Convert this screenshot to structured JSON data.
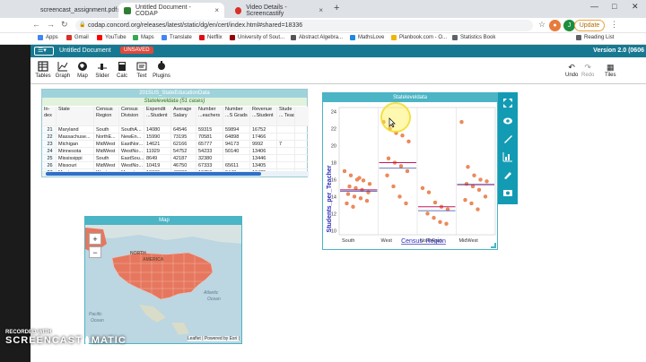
{
  "browser": {
    "tabs": [
      {
        "title": "screencast_assignment.pdf",
        "color": "#e94235"
      },
      {
        "title": "Untitled Document - CODAP",
        "color": "#2e7d32"
      },
      {
        "title": "Video Details - Screencastify",
        "color": "#d93025"
      }
    ],
    "url": "codap.concord.org/releases/latest/static/dg/en/cert/index.html#shared=18336",
    "update_label": "Update",
    "bookmarks": [
      {
        "label": "Apps",
        "color": "#4285f4"
      },
      {
        "label": "Gmail",
        "color": "#d93025"
      },
      {
        "label": "YouTube",
        "color": "#ff0000"
      },
      {
        "label": "Maps",
        "color": "#34a853"
      },
      {
        "label": "Translate",
        "color": "#4285f4"
      },
      {
        "label": "Netflix",
        "color": "#e50914"
      },
      {
        "label": "University of Sout...",
        "color": "#990000"
      },
      {
        "label": "Abstract Algebra...",
        "color": "#555555"
      },
      {
        "label": "MathsLove",
        "color": "#1e88e5"
      },
      {
        "label": "Planbook.com - O...",
        "color": "#f4b400"
      },
      {
        "label": "Statistics Book",
        "color": "#5f6368"
      }
    ],
    "reading_list": "Reading List"
  },
  "codap": {
    "doc_title": "Untitled Document",
    "unsaved": "UNSAVED",
    "version": "Version 2.0 (0606",
    "tools": [
      "Tables",
      "Graph",
      "Map",
      "Slider",
      "Calc",
      "Text",
      "Plugins"
    ],
    "right_tools": [
      "Undo",
      "Redo",
      "Tiles"
    ]
  },
  "table": {
    "title": "2015US_StateEducationData",
    "case_header": "Stateleveldata (51 cases)",
    "columns": [
      "In-\ndex",
      "State",
      "Census\nRegion",
      "Census\nDivision",
      "Expendit\n...Student",
      "Average\nSalary",
      "Number\n...eachers",
      "Number\n...S Grads",
      "Revenue\n...Student",
      "Stude\n... Teac"
    ],
    "rows": [
      [
        "21",
        "Maryland",
        "South",
        "SouthA...",
        "14080",
        "64546",
        "59315",
        "59894",
        "16752",
        ""
      ],
      [
        "22",
        "Massachuse...",
        "NorthE...",
        "NewEn...",
        "15990",
        "73195",
        "70581",
        "64898",
        "17466",
        ""
      ],
      [
        "23",
        "Michigan",
        "MidWest",
        "EastNor...",
        "14621",
        "62166",
        "65777",
        "94173",
        "9992",
        "7"
      ],
      [
        "24",
        "Minnesota",
        "MidWest",
        "WestNo...",
        "11929",
        "54752",
        "54233",
        "50140",
        "13406",
        ""
      ],
      [
        "25",
        "Mississippi",
        "South",
        "EastSou...",
        "8649",
        "42187",
        "32380",
        "",
        "13446",
        ""
      ],
      [
        "26",
        "Missouri",
        "MidWest",
        "WestNo...",
        "10419",
        "46750",
        "67333",
        "65611",
        "13405",
        ""
      ],
      [
        "27",
        "Montana",
        "West",
        "Mounta...",
        "10365",
        "48983",
        "10750",
        "9443",
        "13425",
        ""
      ]
    ]
  },
  "graph": {
    "title": "Stateleveldata",
    "xlabel": "Census_Region",
    "ylabel": "Students_per_Teacher",
    "yticks": [
      "24",
      "22",
      "20",
      "18",
      "16",
      "14",
      "12",
      "10"
    ],
    "chart_data": {
      "type": "scatter",
      "categories": [
        "South",
        "West",
        "NorthEast",
        "MidWest"
      ],
      "ylim": [
        9.5,
        24.5
      ],
      "means": [
        14.8,
        18.0,
        12.8,
        15.4
      ],
      "medians": [
        14.8,
        17.5,
        12.5,
        15.6
      ],
      "points": {
        "South": [
          17.0,
          16.5,
          16.0,
          15.9,
          15.5,
          15.2,
          15.0,
          14.8,
          14.5,
          14.3,
          14.0,
          13.8,
          13.5,
          13.2,
          12.8,
          16.2
        ],
        "West": [
          22.8,
          22.0,
          21.5,
          21.2,
          20.5,
          18.5,
          18.0,
          17.6,
          17.0,
          16.5,
          15.2,
          14.0,
          13.2
        ],
        "NorthEast": [
          15.0,
          14.5,
          13.3,
          12.8,
          12.5,
          12.0,
          11.5,
          11.0,
          10.8
        ],
        "MidWest": [
          22.8,
          17.5,
          16.5,
          16.0,
          15.8,
          15.5,
          15.2,
          14.8,
          14.0,
          13.6,
          13.2,
          12.5
        ]
      }
    }
  },
  "map": {
    "title": "Map",
    "zoom_in": "+",
    "zoom_out": "−",
    "labels": [
      "NORTH",
      "AMERICA",
      "Atlantic",
      "Ocean",
      "Pacific",
      "Ocean"
    ],
    "attribution": "Leaflet | Powered by Esri |"
  },
  "watermark": {
    "line1": "RECORDED WITH",
    "line2": "SCREENCAST",
    "line3": "MATIC"
  }
}
